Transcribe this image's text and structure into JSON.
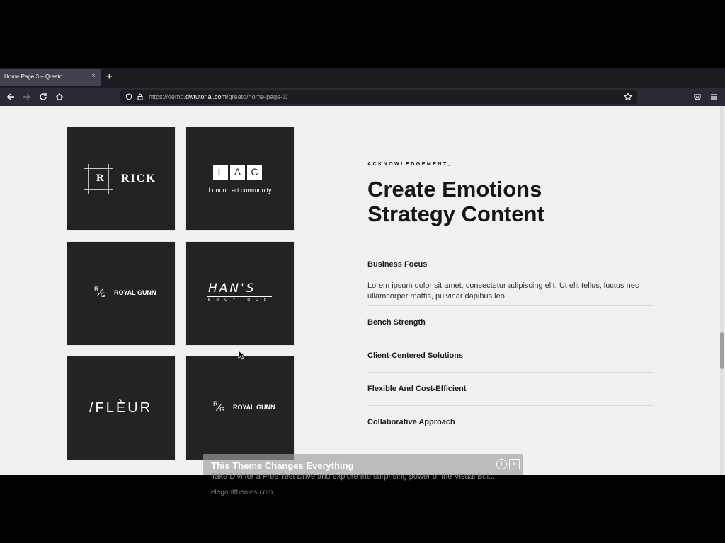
{
  "browser": {
    "tab_title": "Home Page 3 – Qreato",
    "tab_close": "×",
    "new_tab": "+",
    "url_prefix": "https://demo.",
    "url_domain": "dwtutorial.com",
    "url_path": "/qreato/home-page-3/"
  },
  "logos": {
    "rick": "RICK",
    "rick_mark": "R",
    "lac_letters": [
      "L",
      "A",
      "C"
    ],
    "lac_sub": "London art community",
    "royal_gunn_mark_r": "R",
    "royal_gunn_mark_g": "G",
    "royal_gunn": "ROYAL GUNN",
    "hans": "HAN'S",
    "hans_sub": "BOUTIQUE",
    "fleur": "/FLÈUR"
  },
  "content": {
    "eyebrow": "ACKNOWLEDGEMENT_",
    "headline_1": "Create Emotions",
    "headline_2": "Strategy Content",
    "accordion": [
      {
        "title": "Business Focus",
        "body": "Lorem ipsum dolor sit amet, consectetur adipiscing elit. Ut elit tellus, luctus nec ullamcorper mattis, pulvinar dapibus leo."
      },
      {
        "title": "Bench Strength"
      },
      {
        "title": "Client-Centered Solutions"
      },
      {
        "title": "Flexible And Cost-Efficient"
      },
      {
        "title": "Collaborative Approach"
      }
    ]
  },
  "ad": {
    "title": "This Theme Changes Everything",
    "text": "Take Divi for a Free Test Drive and explore the surprising power of the Visual Bui...",
    "site": "elegantthemes.com",
    "info": "i",
    "close": "✕"
  },
  "colors": {
    "page_bg": "#f1f1f1",
    "tile_bg": "#232323",
    "text_dark": "#161616",
    "browser_chrome": "#2b2a33"
  }
}
